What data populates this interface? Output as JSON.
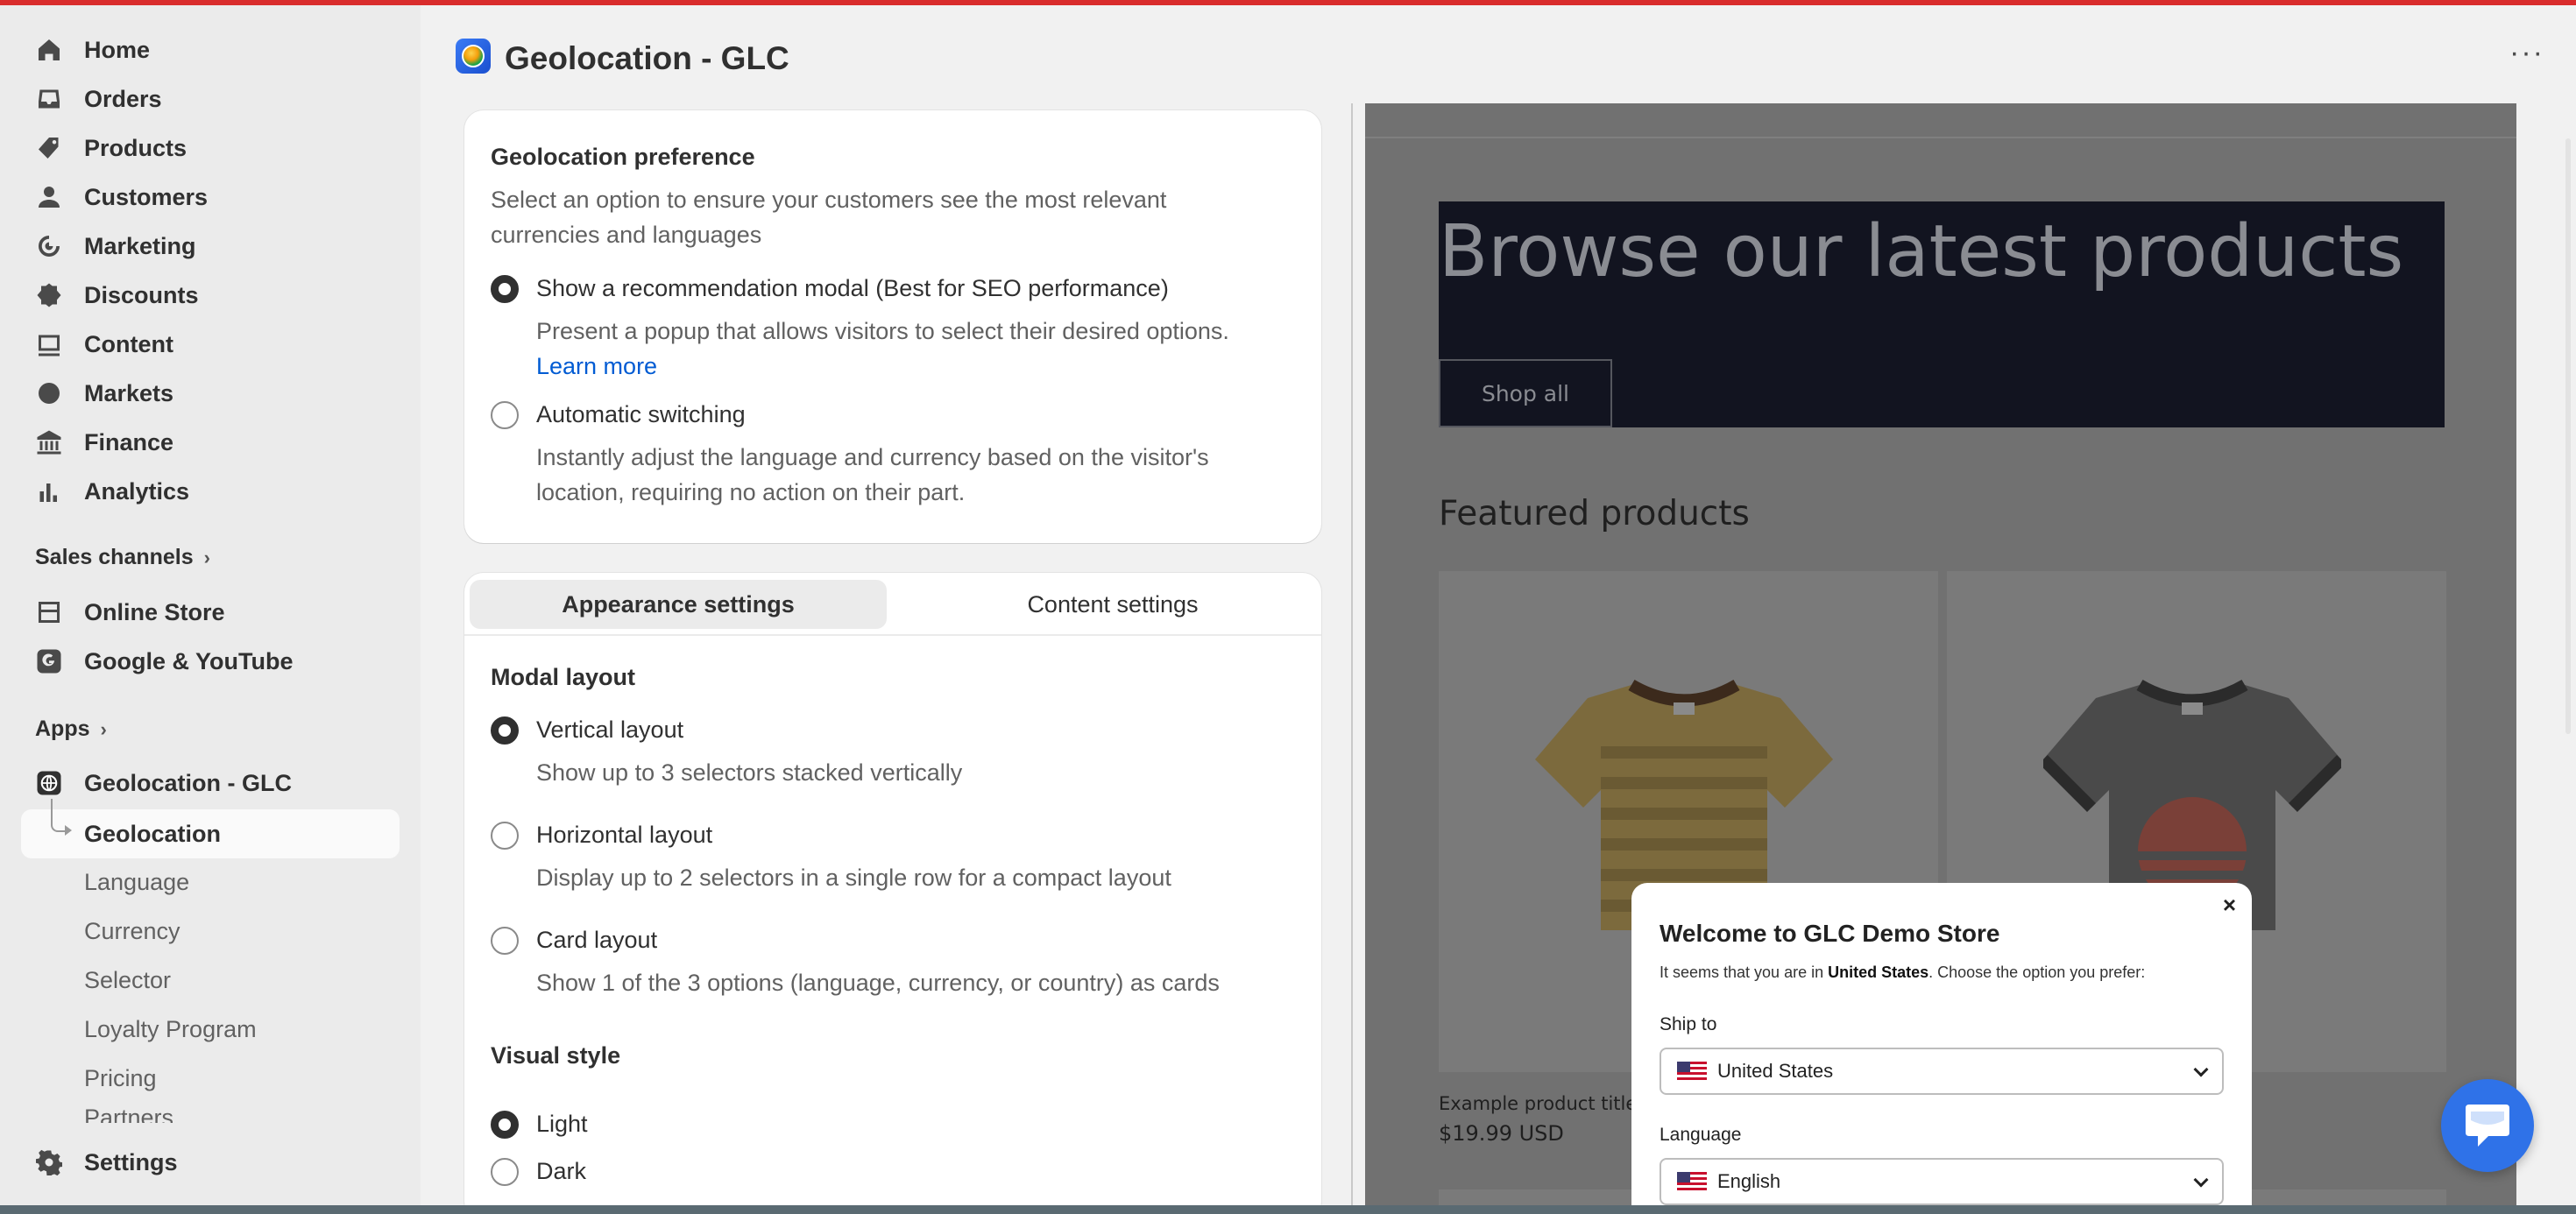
{
  "sidebar": {
    "items": [
      {
        "label": "Home",
        "icon": "home-icon"
      },
      {
        "label": "Orders",
        "icon": "inbox-icon"
      },
      {
        "label": "Products",
        "icon": "tag-icon"
      },
      {
        "label": "Customers",
        "icon": "person-icon"
      },
      {
        "label": "Marketing",
        "icon": "target-icon"
      },
      {
        "label": "Discounts",
        "icon": "discount-icon"
      },
      {
        "label": "Content",
        "icon": "image-icon"
      },
      {
        "label": "Markets",
        "icon": "globe-icon"
      },
      {
        "label": "Finance",
        "icon": "bank-icon"
      },
      {
        "label": "Analytics",
        "icon": "bar-chart-icon"
      }
    ],
    "sales_channels_title": "Sales channels",
    "channels": [
      {
        "label": "Online Store",
        "icon": "store-icon"
      },
      {
        "label": "Google & YouTube",
        "icon": "google-icon"
      }
    ],
    "apps_title": "Apps",
    "app": {
      "label": "Geolocation - GLC",
      "icon": "globe-app-icon"
    },
    "app_sub": [
      "Geolocation",
      "Language",
      "Currency",
      "Selector",
      "Loyalty Program",
      "Pricing",
      "Partners"
    ],
    "settings_label": "Settings"
  },
  "header": {
    "title": "Geolocation - GLC",
    "more_label": "···"
  },
  "preference": {
    "title": "Geolocation preference",
    "description": "Select an option to ensure your customers see the most relevant currencies and languages",
    "options": [
      {
        "label": "Show a recommendation modal (Best for SEO performance)",
        "desc": "Present a popup that allows visitors to select their desired options.",
        "link": "Learn more",
        "selected": true
      },
      {
        "label": "Automatic switching",
        "desc": "Instantly adjust the language and currency based on the visitor's location, requiring no action on their part.",
        "selected": false
      }
    ]
  },
  "settings_tabs": {
    "appearance": "Appearance settings",
    "content": "Content settings"
  },
  "modal_layout": {
    "title": "Modal layout",
    "options": [
      {
        "label": "Vertical layout",
        "desc": "Show up to 3 selectors stacked vertically",
        "selected": true
      },
      {
        "label": "Horizontal layout",
        "desc": "Display up to 2 selectors in a single row for a compact layout",
        "selected": false
      },
      {
        "label": "Card layout",
        "desc": "Show 1 of the 3 options (language, currency, or country) as cards",
        "selected": false
      }
    ]
  },
  "visual_style": {
    "title": "Visual style",
    "options": [
      {
        "label": "Light",
        "selected": true
      },
      {
        "label": "Dark",
        "selected": false
      }
    ]
  },
  "preview": {
    "banner_title": "Browse our latest products",
    "shop_all": "Shop all",
    "featured": "Featured products",
    "product_title": "Example product title",
    "product_price": "$19.99 USD",
    "modal": {
      "close": "×",
      "title": "Welcome to GLC Demo Store",
      "sub_prefix": "It seems that you are in ",
      "sub_country": "United States",
      "sub_suffix": ". Choose the option you prefer:",
      "ship_label": "Ship to",
      "ship_value": "United States",
      "language_label": "Language",
      "language_value": "English"
    }
  },
  "colors": {
    "accent": "#303030",
    "link": "#005bd3",
    "chat": "#2f72e8"
  }
}
